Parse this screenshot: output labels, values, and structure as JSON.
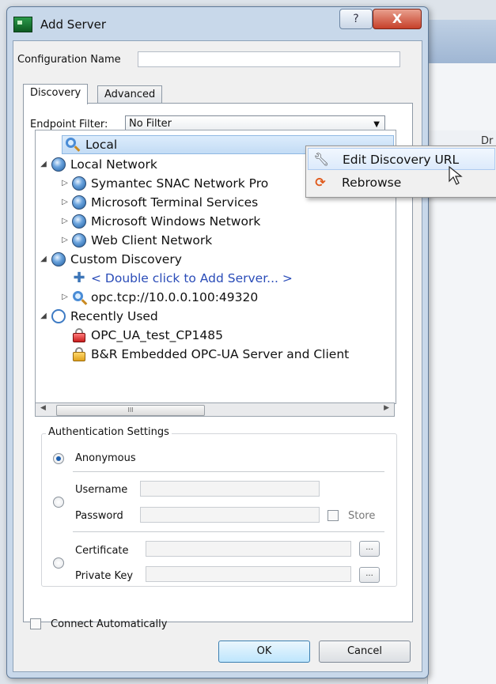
{
  "window": {
    "title": "Add Server",
    "help_glyph": "?",
    "close_glyph": "X"
  },
  "config": {
    "label": "Configuration Name",
    "value": ""
  },
  "tabs": [
    {
      "label": "Discovery",
      "active": true
    },
    {
      "label": "Advanced",
      "active": false
    }
  ],
  "endpoint_filter": {
    "label": "Endpoint Filter:",
    "value": "No Filter"
  },
  "tree": {
    "items": [
      {
        "label": "Local",
        "icon": "magnifier-icon",
        "selected": true
      },
      {
        "label": "Local Network",
        "icon": "globe-icon",
        "expander": "◢"
      },
      {
        "label": "Symantec SNAC Network Pro",
        "icon": "network-globe-icon",
        "expander": "▷"
      },
      {
        "label": "Microsoft Terminal Services",
        "icon": "network-globe-icon",
        "expander": "▷"
      },
      {
        "label": "Microsoft Windows Network",
        "icon": "network-globe-icon",
        "expander": "▷"
      },
      {
        "label": "Web Client Network",
        "icon": "network-globe-icon",
        "expander": "▷"
      },
      {
        "label": "Custom Discovery",
        "icon": "globe-icon",
        "expander": "◢"
      },
      {
        "label": "< Double click to Add Server... >",
        "icon": "plus-icon"
      },
      {
        "label": "opc.tcp://10.0.0.100:49320",
        "icon": "magnifier-icon",
        "expander": "▷"
      },
      {
        "label": "Recently Used",
        "icon": "clock-icon",
        "expander": "◢"
      },
      {
        "label": "OPC_UA_test_CP1485",
        "icon": "red-lock-icon"
      },
      {
        "label": "B&R Embedded OPC-UA Server and Client",
        "icon": "gold-lock-icon"
      }
    ],
    "scroll_thumb_glyph": "III",
    "scroll_left_glyph": "◀",
    "scroll_right_glyph": "▶"
  },
  "context_menu": {
    "items": [
      {
        "label": "Edit Discovery URL",
        "icon": "wrench-icon",
        "hover": true
      },
      {
        "label": "Rebrowse",
        "icon": "refresh-icon",
        "hover": false
      }
    ]
  },
  "auth": {
    "title": "Authentication Settings",
    "anonymous_label": "Anonymous",
    "username_label": "Username",
    "password_label": "Password",
    "store_label": "Store",
    "certificate_label": "Certificate",
    "private_key_label": "Private Key",
    "browse_glyph": "..."
  },
  "footer": {
    "connect_label": "Connect Automatically",
    "ok_label": "OK",
    "cancel_label": "Cancel"
  },
  "background": {
    "column_header": "Dr"
  },
  "colors": {
    "title_bar": "#c8d8ea",
    "selection": "#c3dcf5",
    "link_text": "#2a4cb8",
    "close_button": "#c6402a"
  }
}
